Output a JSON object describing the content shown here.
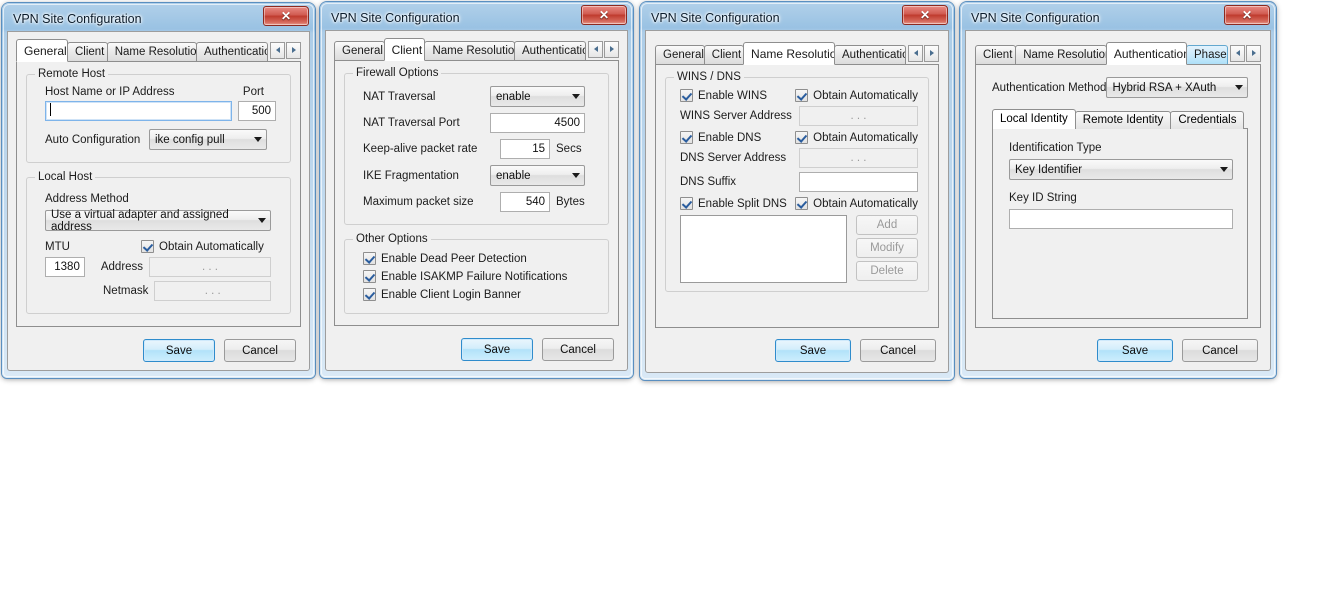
{
  "common": {
    "window_title": "VPN Site Configuration",
    "close_icon": "close-icon",
    "save_label": "Save",
    "cancel_label": "Cancel",
    "scroll_left_icon": "chevron-left-icon",
    "scroll_right_icon": "chevron-right-icon",
    "obtain_automatically_label": "Obtain Automatically",
    "accent_color": "#2f8ccc",
    "close_color": "#bf3a2d",
    "titlebar_color": "#96c0e2"
  },
  "windows": [
    {
      "id": "general",
      "tabs": [
        {
          "label": "General",
          "active": true
        },
        {
          "label": "Client",
          "active": false
        },
        {
          "label": "Name Resolution",
          "active": false
        },
        {
          "label": "Authentication",
          "active": false,
          "clipped": true
        }
      ],
      "groups": {
        "remote_host": {
          "title": "Remote Host",
          "host_label": "Host Name or IP Address",
          "host_value": "",
          "port_label": "Port",
          "port_value": "500",
          "auto_config_label": "Auto Configuration",
          "auto_config_value": "ike config pull"
        },
        "local_host": {
          "title": "Local Host",
          "address_method_label": "Address Method",
          "address_method_value": "Use a virtual adapter and assigned address",
          "mtu_label": "MTU",
          "mtu_value": "1380",
          "obtain_label": "Obtain Automatically",
          "obtain_checked": true,
          "address_label": "Address",
          "address_value": ".         .         .",
          "netmask_label": "Netmask",
          "netmask_value": ".         .         ."
        }
      }
    },
    {
      "id": "client",
      "tabs": [
        {
          "label": "General",
          "active": false
        },
        {
          "label": "Client",
          "active": true
        },
        {
          "label": "Name Resolution",
          "active": false
        },
        {
          "label": "Authentication",
          "active": false,
          "clipped": true
        }
      ],
      "groups": {
        "firewall": {
          "title": "Firewall Options",
          "rows": [
            {
              "label": "NAT Traversal",
              "type": "combo",
              "value": "enable",
              "unit": ""
            },
            {
              "label": "NAT Traversal Port",
              "type": "text",
              "value": "4500",
              "unit": ""
            },
            {
              "label": "Keep-alive packet rate",
              "type": "text-short",
              "value": "15",
              "unit": "Secs"
            },
            {
              "label": "IKE Fragmentation",
              "type": "combo",
              "value": "enable",
              "unit": ""
            },
            {
              "label": "Maximum packet size",
              "type": "text-short",
              "value": "540",
              "unit": "Bytes"
            }
          ]
        },
        "other": {
          "title": "Other Options",
          "checkboxes": [
            {
              "label": "Enable Dead Peer Detection",
              "checked": true
            },
            {
              "label": "Enable ISAKMP Failure Notifications",
              "checked": true
            },
            {
              "label": "Enable Client Login Banner",
              "checked": true
            }
          ]
        }
      }
    },
    {
      "id": "name-resolution",
      "tabs": [
        {
          "label": "General",
          "active": false
        },
        {
          "label": "Client",
          "active": false
        },
        {
          "label": "Name Resolution",
          "active": true
        },
        {
          "label": "Authentication",
          "active": false,
          "clipped": true
        }
      ],
      "groups": {
        "wins_dns": {
          "title": "WINS / DNS",
          "enable_wins_label": "Enable WINS",
          "enable_wins_checked": true,
          "wins_obtain_label": "Obtain Automatically",
          "wins_obtain_checked": true,
          "wins_server_label": "WINS Server Address",
          "wins_server_value": ".         .         .",
          "enable_dns_label": "Enable DNS",
          "enable_dns_checked": true,
          "dns_obtain_label": "Obtain Automatically",
          "dns_obtain_checked": true,
          "dns_server_label": "DNS Server Address",
          "dns_server_value": ".         .         .",
          "dns_suffix_label": "DNS Suffix",
          "dns_suffix_value": "",
          "enable_split_dns_label": "Enable Split DNS",
          "enable_split_dns_checked": true,
          "split_obtain_label": "Obtain Automatically",
          "split_obtain_checked": true,
          "list_items": [],
          "add_label": "Add",
          "modify_label": "Modify",
          "delete_label": "Delete"
        }
      }
    },
    {
      "id": "authentication",
      "tabs": [
        {
          "label": "Client",
          "active": false
        },
        {
          "label": "Name Resolution",
          "active": false
        },
        {
          "label": "Authentication",
          "active": true
        },
        {
          "label": "Phase",
          "active": false,
          "hover": true,
          "clipped": true
        }
      ],
      "auth": {
        "method_label": "Authentication Method",
        "method_value": "Hybrid RSA + XAuth",
        "inner_tabs": [
          {
            "label": "Local Identity",
            "active": true
          },
          {
            "label": "Remote Identity",
            "active": false
          },
          {
            "label": "Credentials",
            "active": false
          }
        ],
        "id_type_label": "Identification Type",
        "id_type_value": "Key Identifier",
        "key_id_label": "Key ID String",
        "key_id_value": ""
      }
    }
  ]
}
